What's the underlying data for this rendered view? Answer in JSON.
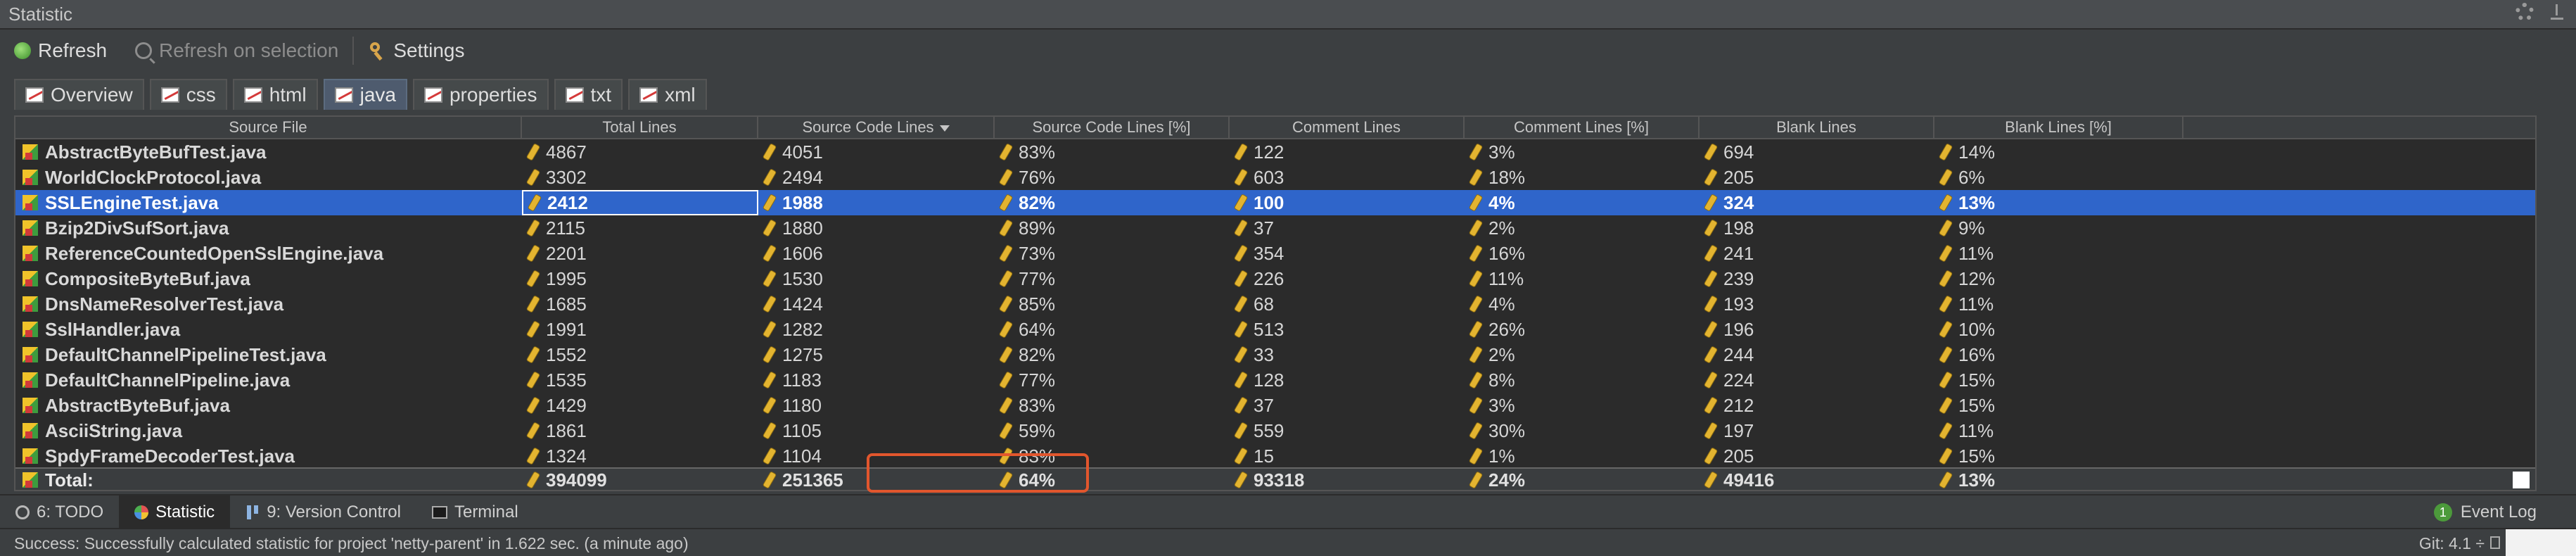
{
  "window": {
    "title": "Statistic"
  },
  "toolbar": {
    "refresh": "Refresh",
    "refresh_on_selection": "Refresh on selection",
    "settings": "Settings"
  },
  "tabs": [
    {
      "label": "Overview",
      "icon": "overview-icon",
      "active": false
    },
    {
      "label": "css",
      "icon": "chart-icon",
      "active": false
    },
    {
      "label": "html",
      "icon": "chart-icon",
      "active": false
    },
    {
      "label": "java",
      "icon": "chart-icon",
      "active": true
    },
    {
      "label": "properties",
      "icon": "chart-icon",
      "active": false
    },
    {
      "label": "txt",
      "icon": "chart-icon",
      "active": false
    },
    {
      "label": "xml",
      "icon": "chart-icon",
      "active": false
    }
  ],
  "table": {
    "columns": [
      "Source File",
      "Total Lines",
      "Source Code Lines",
      "Source Code Lines [%]",
      "Comment Lines",
      "Comment Lines [%]",
      "Blank Lines",
      "Blank Lines [%]"
    ],
    "sorted_column_index": 2,
    "sort_direction": "descending",
    "selected_row_index": 2,
    "rows": [
      [
        "AbstractByteBufTest.java",
        "4867",
        "4051",
        "83%",
        "122",
        "3%",
        "694",
        "14%"
      ],
      [
        "WorldClockProtocol.java",
        "3302",
        "2494",
        "76%",
        "603",
        "18%",
        "205",
        "6%"
      ],
      [
        "SSLEngineTest.java",
        "2412",
        "1988",
        "82%",
        "100",
        "4%",
        "324",
        "13%"
      ],
      [
        "Bzip2DivSufSort.java",
        "2115",
        "1880",
        "89%",
        "37",
        "2%",
        "198",
        "9%"
      ],
      [
        "ReferenceCountedOpenSslEngine.java",
        "2201",
        "1606",
        "73%",
        "354",
        "16%",
        "241",
        "11%"
      ],
      [
        "CompositeByteBuf.java",
        "1995",
        "1530",
        "77%",
        "226",
        "11%",
        "239",
        "12%"
      ],
      [
        "DnsNameResolverTest.java",
        "1685",
        "1424",
        "85%",
        "68",
        "4%",
        "193",
        "11%"
      ],
      [
        "SslHandler.java",
        "1991",
        "1282",
        "64%",
        "513",
        "26%",
        "196",
        "10%"
      ],
      [
        "DefaultChannelPipelineTest.java",
        "1552",
        "1275",
        "82%",
        "33",
        "2%",
        "244",
        "16%"
      ],
      [
        "DefaultChannelPipeline.java",
        "1535",
        "1183",
        "77%",
        "128",
        "8%",
        "224",
        "15%"
      ],
      [
        "AbstractByteBuf.java",
        "1429",
        "1180",
        "83%",
        "37",
        "3%",
        "212",
        "15%"
      ],
      [
        "AsciiString.java",
        "1861",
        "1105",
        "59%",
        "559",
        "30%",
        "197",
        "11%"
      ],
      [
        "SpdyFrameDecoderTest.java",
        "1324",
        "1104",
        "83%",
        "15",
        "1%",
        "205",
        "15%"
      ]
    ],
    "total": [
      "Total:",
      "394099",
      "251365",
      "64%",
      "93318",
      "24%",
      "49416",
      "13%"
    ]
  },
  "bottom_tools": [
    {
      "label": "6: TODO",
      "icon": "todo-icon",
      "active": false
    },
    {
      "label": "Statistic",
      "icon": "statistic-icon",
      "active": true
    },
    {
      "label": "9: Version Control",
      "icon": "version-control-icon",
      "active": false
    },
    {
      "label": "Terminal",
      "icon": "terminal-icon",
      "active": false
    }
  ],
  "event_log": {
    "label": "Event Log",
    "count": "1"
  },
  "status": {
    "message": "Success: Successfully calculated statistic for project 'netty-parent' in 1.622 sec. (a minute ago)",
    "git": "Git: 4.1 ÷"
  },
  "colors": {
    "background": "#3c3f41",
    "table_background": "#2b2b2b",
    "selection": "#2f65ca",
    "highlight_box": "#e2562d"
  }
}
